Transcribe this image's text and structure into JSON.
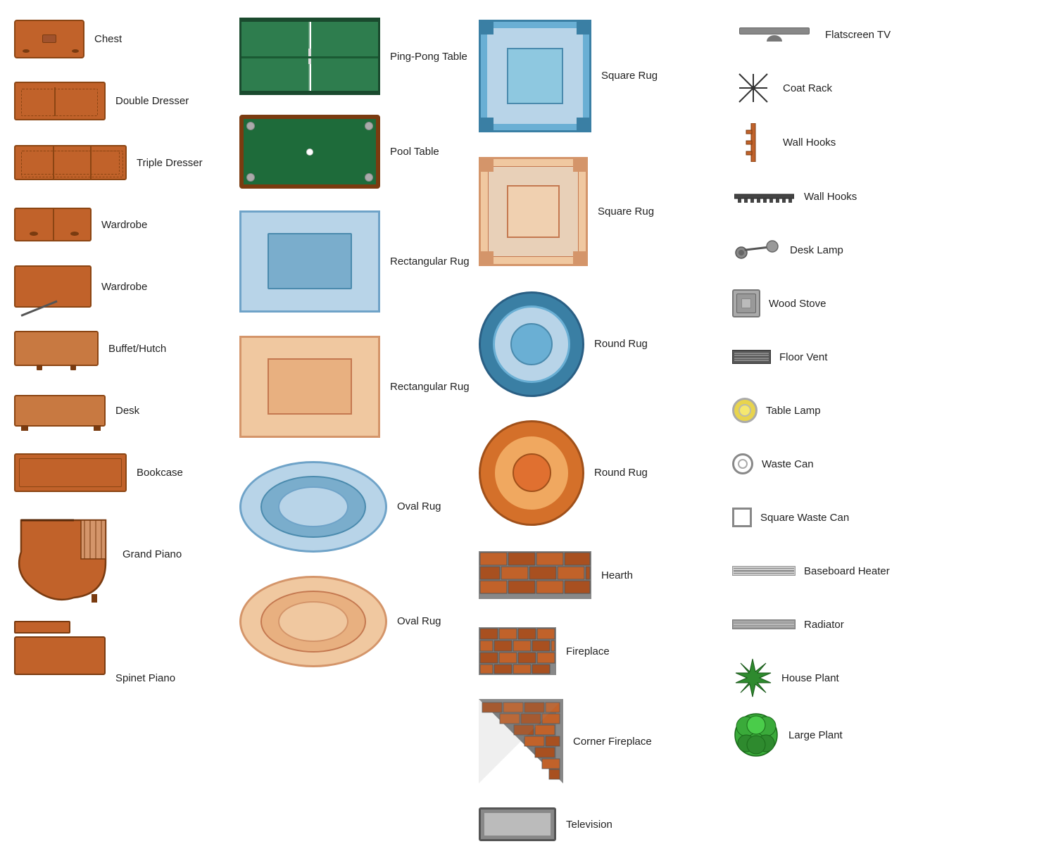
{
  "col1": {
    "items": [
      {
        "id": "chest",
        "label": "Chest"
      },
      {
        "id": "double-dresser",
        "label": "Double Dresser"
      },
      {
        "id": "triple-dresser",
        "label": "Triple Dresser"
      },
      {
        "id": "wardrobe1",
        "label": "Wardrobe"
      },
      {
        "id": "wardrobe2",
        "label": "Wardrobe"
      },
      {
        "id": "buffet",
        "label": "Buffet/Hutch"
      },
      {
        "id": "desk",
        "label": "Desk"
      },
      {
        "id": "bookcase",
        "label": "Bookcase"
      },
      {
        "id": "grand-piano",
        "label": "Grand Piano"
      },
      {
        "id": "spinet-piano",
        "label": "Spinet Piano"
      }
    ]
  },
  "col2": {
    "items": [
      {
        "id": "ping-pong",
        "label": "Ping-Pong Table"
      },
      {
        "id": "pool-table",
        "label": "Pool Table"
      },
      {
        "id": "rect-rug-blue",
        "label": "Rectangular Rug"
      },
      {
        "id": "rect-rug-peach",
        "label": "Rectangular Rug"
      },
      {
        "id": "oval-rug-blue",
        "label": "Oval Rug"
      },
      {
        "id": "oval-rug-peach",
        "label": "Oval Rug"
      }
    ]
  },
  "col3": {
    "items": [
      {
        "id": "square-rug-blue",
        "label": "Square Rug"
      },
      {
        "id": "square-rug-peach",
        "label": "Square Rug"
      },
      {
        "id": "round-rug-blue",
        "label": "Round Rug"
      },
      {
        "id": "round-rug-orange",
        "label": "Round Rug"
      },
      {
        "id": "hearth",
        "label": "Hearth"
      },
      {
        "id": "fireplace",
        "label": "Fireplace"
      },
      {
        "id": "corner-fireplace",
        "label": "Corner Fireplace"
      },
      {
        "id": "television",
        "label": "Television"
      }
    ]
  },
  "col4": {
    "items": [
      {
        "id": "flatscreen",
        "label": "Flatscreen TV"
      },
      {
        "id": "coat-rack",
        "label": "Coat Rack"
      },
      {
        "id": "wall-hooks1",
        "label": "Wall Hooks"
      },
      {
        "id": "wall-hooks2",
        "label": "Wall Hooks"
      },
      {
        "id": "desk-lamp",
        "label": "Desk Lamp"
      },
      {
        "id": "wood-stove",
        "label": "Wood Stove"
      },
      {
        "id": "floor-vent",
        "label": "Floor Vent"
      },
      {
        "id": "table-lamp",
        "label": "Table Lamp"
      },
      {
        "id": "waste-can",
        "label": "Waste Can"
      },
      {
        "id": "square-waste-can",
        "label": "Square Waste Can"
      },
      {
        "id": "baseboard-heater",
        "label": "Baseboard Heater"
      },
      {
        "id": "radiator",
        "label": "Radiator"
      },
      {
        "id": "house-plant",
        "label": "House Plant"
      },
      {
        "id": "large-plant",
        "label": "Large Plant"
      }
    ]
  }
}
